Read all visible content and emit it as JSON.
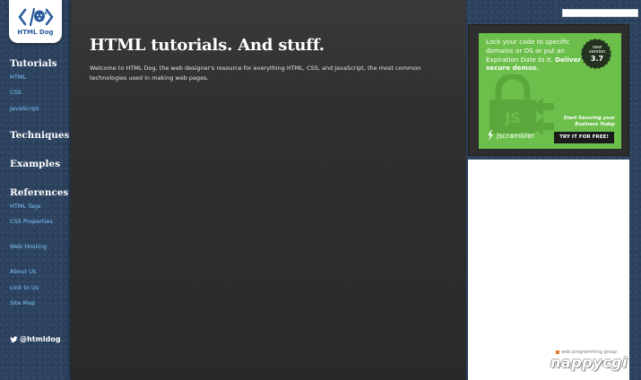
{
  "brand": {
    "logo_text": "HTML Dog"
  },
  "sidebar": {
    "sections": [
      {
        "heading": "Tutorials",
        "links": [
          "HTML",
          "CSS",
          "JavaScript"
        ]
      },
      {
        "heading": "Techniques"
      },
      {
        "heading": "Examples"
      },
      {
        "heading": "References",
        "links": [
          "HTML Tags",
          "CSS Properties"
        ]
      }
    ],
    "extra_links": [
      "Web Hosting",
      "About Us",
      "Link to Us",
      "Site Map"
    ],
    "twitter": "@htmldog"
  },
  "main": {
    "title": "HTML tutorials. And stuff.",
    "intro": "Welcome to HTML Dog, the web designer's resource for everything HTML, CSS, and JavaScript, the most common technologies used in making web pages."
  },
  "ad": {
    "headline": "Lock your code to specific domains or OS or put an Expiration Date to it.",
    "headline_cta": "Deliver secure demos.",
    "badge_new": "new",
    "badge_version_label": "version",
    "badge_version": "3.7",
    "lock_text": "JS",
    "logo_text": "jscrambler",
    "tagline": "Start Securing your Business Today",
    "button": "TRY IT FOR FREE!",
    "bg_color": "#6cbf4a"
  },
  "watermark": {
    "small": "web programming group",
    "big": "nappycgi"
  },
  "colors": {
    "sidebar_bg": "#2d4461",
    "main_bg": "#303030",
    "nav_link": "#7fc7ff",
    "logo_blue": "#2a5b9c"
  }
}
